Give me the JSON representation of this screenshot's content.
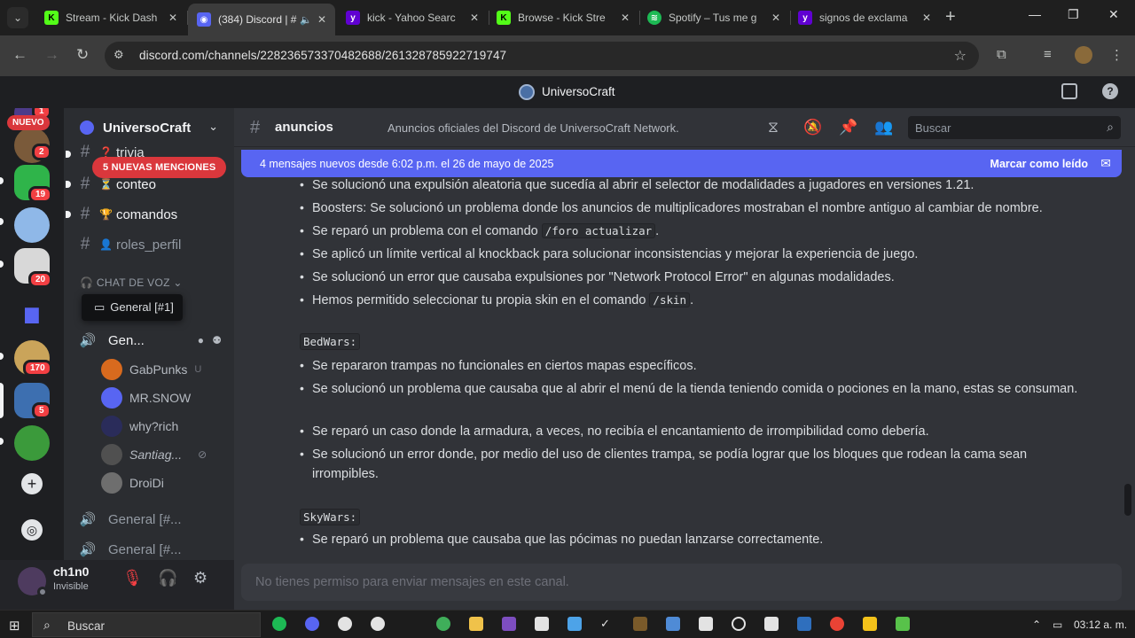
{
  "browser": {
    "tabs": [
      {
        "title": "Stream - Kick Dash",
        "favicon": "kick-icon",
        "color": "#53fc18"
      },
      {
        "title": "(384) Discord | #",
        "favicon": "discord-icon",
        "color": "#5865f2",
        "badge": "384"
      },
      {
        "title": "kick - Yahoo Searc",
        "favicon": "yahoo-icon",
        "color": "#6001d2"
      },
      {
        "title": "Browse - Kick Stre",
        "favicon": "kick-icon",
        "color": "#53fc18"
      },
      {
        "title": "Spotify – Tus me g",
        "favicon": "spotify-icon",
        "color": "#1db954"
      },
      {
        "title": "signos de exclama",
        "favicon": "yahoo-icon",
        "color": "#6001d2"
      }
    ],
    "url": "discord.com/channels/228236573370482688/261328785922719747"
  },
  "app": {
    "title": "UniversoCraft"
  },
  "rail": {
    "new_label": "NUEVO",
    "badges": [
      "1",
      "2",
      "19",
      "20",
      "170",
      "5"
    ]
  },
  "server": {
    "name": "UniversoCraft",
    "mentions_label": "5 NUEVAS MENCIONES",
    "channels": [
      {
        "name": "trivia",
        "emoji": "❓"
      },
      {
        "name": "conteo",
        "emoji": "⏳"
      },
      {
        "name": "comandos",
        "emoji": "🏆"
      },
      {
        "name": "roles_perfil",
        "emoji": "👤"
      }
    ],
    "voice_category": "CHAT DE VOZ",
    "tooltip": "General [#1]",
    "voice_channels": [
      {
        "name": "Gen..."
      },
      {
        "name": "General [#..."
      },
      {
        "name": "General [#..."
      }
    ],
    "members": [
      {
        "name": "GabPunks",
        "extra": "U",
        "color": "#d86a1e"
      },
      {
        "name": "MR.SNOW",
        "extra": "",
        "color": "#5865f2"
      },
      {
        "name": "why?rich",
        "extra": "",
        "color": "#2a2c5a"
      },
      {
        "name": "Santiag...",
        "extra": "",
        "color": "#505050"
      },
      {
        "name": "DroiDi",
        "extra": "",
        "color": "#6e6e6e"
      }
    ]
  },
  "channel": {
    "name": "anuncios",
    "topic": "Anuncios oficiales del Discord de UniversoCraft Network.",
    "search_placeholder": "Buscar"
  },
  "new_messages": {
    "text": "4 mensajes nuevos desde 6:02 p.m. el 26 de mayo de 2025",
    "action": "Marcar como leído"
  },
  "messages": {
    "top_bullets": [
      {
        "text": "Se solucionó una expulsión aleatoria que sucedía al abrir el selector de modalidades a jugadores en versiones 1.21."
      },
      {
        "text": "Boosters: Se solucionó un problema donde los anuncios de multiplicadores mostraban el nombre antiguo al cambiar de nombre."
      },
      {
        "pre": "Se reparó un problema con el comando ",
        "code": "/foro actualizar",
        "post": "."
      },
      {
        "text": "Se aplicó un límite vertical al knockback para solucionar inconsistencias y mejorar la experiencia de juego."
      },
      {
        "text": "Se solucionó un error que causaba expulsiones por \"Network Protocol Error\" en algunas modalidades."
      },
      {
        "pre": "Hemos permitido seleccionar tu propia skin en el comando ",
        "code": "/skin",
        "post": "."
      }
    ],
    "section_bedwars": "BedWars:",
    "bedwars_bullets": [
      "Se repararon trampas no funcionales en ciertos mapas específicos.",
      "Se solucionó un problema que causaba que al abrir el menú de la tienda teniendo comida o pociones en la mano, estas se consuman.",
      "Se reparó un caso donde la armadura, a veces, no recibía el encantamiento de irrompibilidad como debería.",
      "Se solucionó un error donde, por medio del uso de clientes trampa, se podía lograr que los bloques que rodean la cama sean irrompibles."
    ],
    "section_skywars": "SkyWars:",
    "skywars_bullets": [
      "Se reparó un problema que causaba que las pócimas no puedan lanzarse correctamente."
    ]
  },
  "composer": {
    "placeholder": "No tienes permiso para enviar mensajes en este canal."
  },
  "user": {
    "name": "ch1n0",
    "status": "Invisible"
  },
  "taskbar": {
    "search_placeholder": "Buscar",
    "time": "03:12 a. m."
  }
}
